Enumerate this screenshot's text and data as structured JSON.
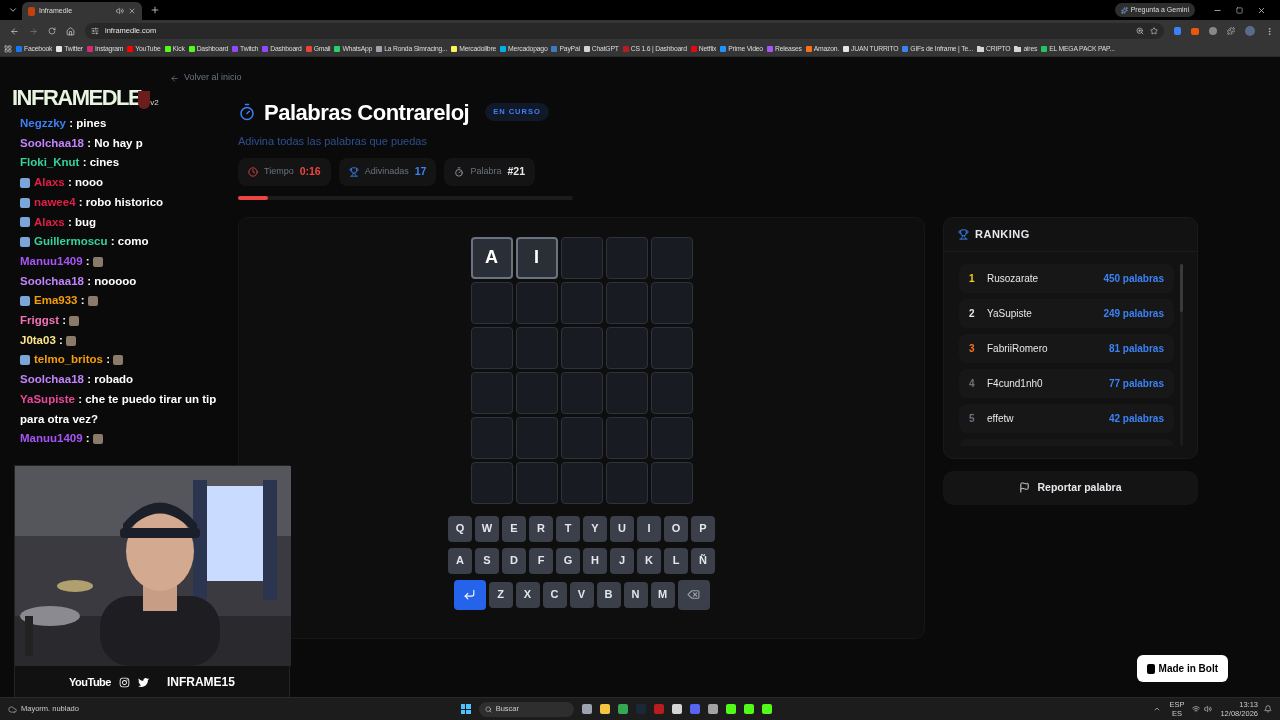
{
  "browser": {
    "tabs": [
      {
        "title": "Inframedle",
        "selected": true
      }
    ],
    "gemini_button": "Pregunta a Gemini",
    "url": "inframedle.com",
    "bookmarks": [
      {
        "label": "Facebook",
        "kind": "link",
        "color": "#1877f2"
      },
      {
        "label": "Twitter",
        "kind": "link",
        "color": "#e5e5e5"
      },
      {
        "label": "Instagram",
        "kind": "link",
        "color": "#d62976"
      },
      {
        "label": "YouTube",
        "kind": "link",
        "color": "#ff0000"
      },
      {
        "label": "Kick",
        "kind": "link",
        "color": "#53fc18"
      },
      {
        "label": "Dashboard",
        "kind": "link",
        "color": "#53fc18"
      },
      {
        "label": "Twitch",
        "kind": "link",
        "color": "#9146ff"
      },
      {
        "label": "Dashboard",
        "kind": "link",
        "color": "#9146ff"
      },
      {
        "label": "Gmail",
        "kind": "link",
        "color": "#ea4335"
      },
      {
        "label": "WhatsApp",
        "kind": "link",
        "color": "#25d366"
      },
      {
        "label": "La Ronda Simracing...",
        "kind": "link",
        "color": "#9ca3af"
      },
      {
        "label": "Mercadolibre",
        "kind": "link",
        "color": "#fff159"
      },
      {
        "label": "Mercadopago",
        "kind": "link",
        "color": "#00b1ea"
      },
      {
        "label": "PayPal",
        "kind": "link",
        "color": "#3b7bbf"
      },
      {
        "label": "ChatGPT",
        "kind": "link",
        "color": "#d4d4d4"
      },
      {
        "label": "CS 1.6 | Dashboard",
        "kind": "link",
        "color": "#b91c1c"
      },
      {
        "label": "Netflix",
        "kind": "link",
        "color": "#e50914"
      },
      {
        "label": "Prime Video",
        "kind": "link",
        "color": "#1a98ff"
      },
      {
        "label": "Releases",
        "kind": "link",
        "color": "#a855f7"
      },
      {
        "label": "Amazon.",
        "kind": "link",
        "color": "#f97316"
      },
      {
        "label": "JUAN TURRITO",
        "kind": "link",
        "color": "#e5e5e5"
      },
      {
        "label": "GIFs de Inframe | Te...",
        "kind": "link",
        "color": "#3b82f6"
      },
      {
        "label": "CRIPTO",
        "kind": "folder",
        "color": "#d4d4d4"
      },
      {
        "label": "aires",
        "kind": "folder",
        "color": "#d4d4d4"
      },
      {
        "label": "EL MEGA PACK PAP...",
        "kind": "link",
        "color": "#22c55e"
      }
    ]
  },
  "stream": {
    "logo": "INFRAMEDLE",
    "logo_version": "v2",
    "separator": ":",
    "chat": [
      {
        "user": "Negzzky",
        "color": "#3b82f6",
        "badge": false,
        "kind": "text",
        "message": "pines"
      },
      {
        "user": "Soolchaa18",
        "color": "#c084fc",
        "badge": false,
        "kind": "text",
        "message": "No hay p"
      },
      {
        "user": "Floki_Knut",
        "color": "#34d399",
        "badge": false,
        "kind": "text",
        "message": "cines"
      },
      {
        "user": "Alaxs",
        "color": "#e11d48",
        "badge": true,
        "kind": "text",
        "message": "nooo"
      },
      {
        "user": "nawee4",
        "color": "#e11d48",
        "badge": true,
        "kind": "text",
        "message": "robo historico"
      },
      {
        "user": "Alaxs",
        "color": "#e11d48",
        "badge": true,
        "kind": "text",
        "message": "bug"
      },
      {
        "user": "Guillermoscu",
        "color": "#34d399",
        "badge": true,
        "kind": "text",
        "message": "como"
      },
      {
        "user": "Manuu1409",
        "color": "#a855f7",
        "badge": false,
        "kind": "emote"
      },
      {
        "user": "Soolchaa18",
        "color": "#c084fc",
        "badge": false,
        "kind": "text",
        "message": "nooooo"
      },
      {
        "user": "Ema933",
        "color": "#f59e0b",
        "badge": true,
        "kind": "emote"
      },
      {
        "user": "Friggst",
        "color": "#f472b6",
        "badge": false,
        "kind": "emote"
      },
      {
        "user": "J0ta03",
        "color": "#fde68a",
        "badge": false,
        "kind": "emote"
      },
      {
        "user": "telmo_britos",
        "color": "#f59e0b",
        "badge": true,
        "kind": "emote"
      },
      {
        "user": "Soolchaa18",
        "color": "#c084fc",
        "badge": false,
        "kind": "text",
        "message": "robado"
      },
      {
        "user": "YaSupiste",
        "color": "#ec4899",
        "badge": false,
        "kind": "text",
        "message": "che te puedo tirar un tip para otra vez?"
      },
      {
        "user": "Manuu1409",
        "color": "#a855f7",
        "badge": false,
        "kind": "emote"
      }
    ],
    "socials": {
      "youtube": "YouTube",
      "handle": "INFRAME15"
    }
  },
  "page": {
    "back_link": "Volver al inicio",
    "title": "Palabras Contrareloj",
    "status": "EN CURSO",
    "subtitle": "Adivina todas las palabras que puedas",
    "stats": [
      {
        "kind": "time",
        "label": "Tiempo",
        "value": "0:16"
      },
      {
        "kind": "guessed",
        "label": "Adivinadas",
        "value": "17"
      },
      {
        "kind": "word",
        "label": "Palabra",
        "value": "#21"
      }
    ],
    "time_bar": {
      "level": 0.09
    },
    "current_guess": [
      "A",
      "I"
    ],
    "keyboard": [
      {
        "keys": [
          {
            "kind": "letter",
            "label": "Q"
          },
          {
            "kind": "letter",
            "label": "W"
          },
          {
            "kind": "letter",
            "label": "E"
          },
          {
            "kind": "letter",
            "label": "R"
          },
          {
            "kind": "letter",
            "label": "T"
          },
          {
            "kind": "letter",
            "label": "Y"
          },
          {
            "kind": "letter",
            "label": "U"
          },
          {
            "kind": "letter",
            "label": "I"
          },
          {
            "kind": "letter",
            "label": "O"
          },
          {
            "kind": "letter",
            "label": "P"
          }
        ]
      },
      {
        "keys": [
          {
            "kind": "letter",
            "label": "A"
          },
          {
            "kind": "letter",
            "label": "S"
          },
          {
            "kind": "letter",
            "label": "D"
          },
          {
            "kind": "letter",
            "label": "F"
          },
          {
            "kind": "letter",
            "label": "G"
          },
          {
            "kind": "letter",
            "label": "H"
          },
          {
            "kind": "letter",
            "label": "J"
          },
          {
            "kind": "letter",
            "label": "K"
          },
          {
            "kind": "letter",
            "label": "L"
          },
          {
            "kind": "letter",
            "label": "Ñ"
          }
        ]
      },
      {
        "keys": [
          {
            "kind": "enter"
          },
          {
            "kind": "letter",
            "label": "Z"
          },
          {
            "kind": "letter",
            "label": "X"
          },
          {
            "kind": "letter",
            "label": "C"
          },
          {
            "kind": "letter",
            "label": "V"
          },
          {
            "kind": "letter",
            "label": "B"
          },
          {
            "kind": "letter",
            "label": "N"
          },
          {
            "kind": "letter",
            "label": "M"
          },
          {
            "kind": "backspace"
          }
        ]
      }
    ],
    "ranking": {
      "title": "RANKING",
      "entries": [
        {
          "rank": "1",
          "name": "Rusozarate",
          "score": "450 palabras",
          "color": "#facc15"
        },
        {
          "rank": "2",
          "name": "YaSupiste",
          "score": "249 palabras",
          "color": "#e5e7eb"
        },
        {
          "rank": "3",
          "name": "FabriiRomero",
          "score": "81 palabras",
          "color": "#f97316"
        },
        {
          "rank": "4",
          "name": "F4cund1nh0",
          "score": "77 palabras",
          "color": "#6b7280"
        },
        {
          "rank": "5",
          "name": "effetw",
          "score": "42 palabras",
          "color": "#6b7280"
        }
      ]
    },
    "report_button": "Reportar palabra",
    "bolt_badge": "Made in Bolt"
  },
  "taskbar": {
    "weather": "Mayorm. nublado",
    "search": "Buscar",
    "language": "ESP",
    "layout": "ES",
    "time": "13:13",
    "date": "12/08/2026"
  }
}
